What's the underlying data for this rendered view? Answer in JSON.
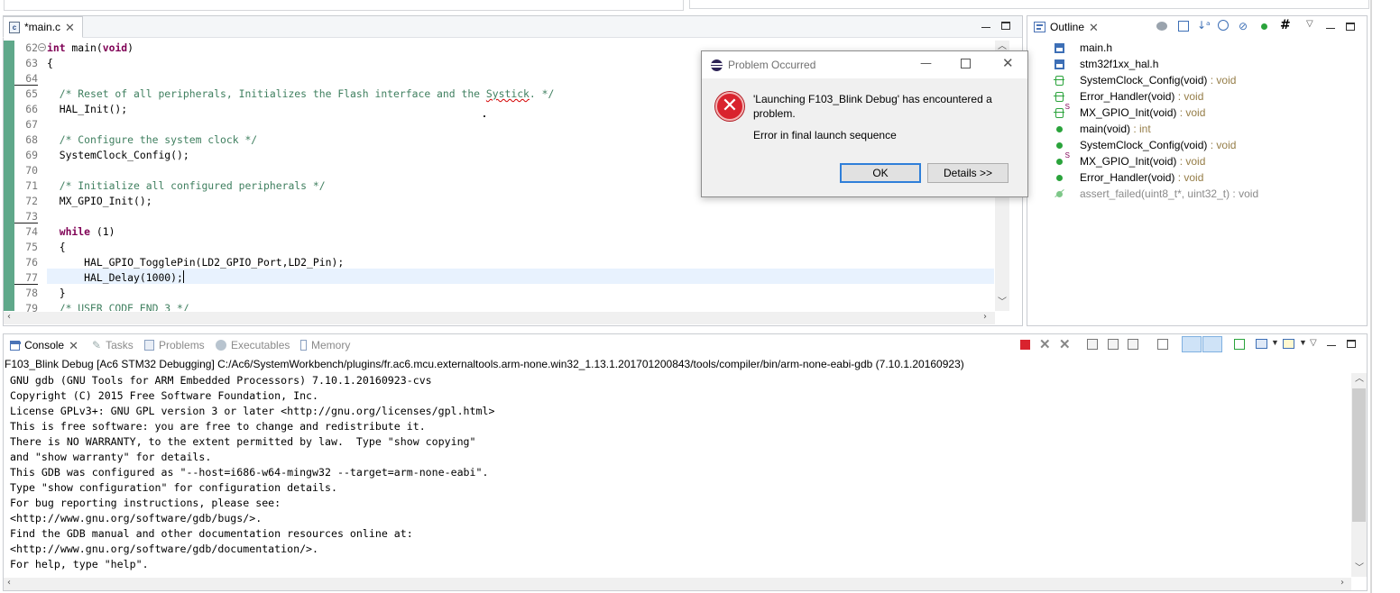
{
  "editor": {
    "tab_title": "*main.c",
    "lines": [
      {
        "num": "62",
        "text": "int main(void)"
      },
      {
        "num": "63",
        "text": "{"
      },
      {
        "num": "64",
        "text": ""
      },
      {
        "num": "65",
        "text": "  /* Reset of all peripherals, Initializes the Flash interface and the Systick. */"
      },
      {
        "num": "66",
        "text": "  HAL_Init();"
      },
      {
        "num": "67",
        "text": ""
      },
      {
        "num": "68",
        "text": "  /* Configure the system clock */"
      },
      {
        "num": "69",
        "text": "  SystemClock_Config();"
      },
      {
        "num": "70",
        "text": ""
      },
      {
        "num": "71",
        "text": "  /* Initialize all configured peripherals */"
      },
      {
        "num": "72",
        "text": "  MX_GPIO_Init();"
      },
      {
        "num": "73",
        "text": ""
      },
      {
        "num": "74",
        "text": "  while (1)"
      },
      {
        "num": "75",
        "text": "  {"
      },
      {
        "num": "76",
        "text": "      HAL_GPIO_TogglePin(LD2_GPIO_Port,LD2_Pin);"
      },
      {
        "num": "77",
        "text": "      HAL_Delay(1000);"
      },
      {
        "num": "78",
        "text": "  }"
      },
      {
        "num": "79",
        "text": "  /* USER CODE END 3 */"
      }
    ]
  },
  "outline": {
    "tab_title": "Outline",
    "items": [
      {
        "name": "main.h",
        "type": "",
        "icon": "header-file-icon"
      },
      {
        "name": "stm32f1xx_hal.h",
        "type": "",
        "icon": "header-file-icon"
      },
      {
        "name": "SystemClock_Config(void)",
        "type": " : void",
        "icon": "function-prototype-icon"
      },
      {
        "name": "Error_Handler(void)",
        "type": " : void",
        "icon": "function-prototype-icon"
      },
      {
        "name": "MX_GPIO_Init(void)",
        "type": " : void",
        "icon": "static-function-prototype-icon"
      },
      {
        "name": "main(void)",
        "type": " : int",
        "icon": "function-icon"
      },
      {
        "name": "SystemClock_Config(void)",
        "type": " : void",
        "icon": "function-icon"
      },
      {
        "name": "MX_GPIO_Init(void)",
        "type": " : void",
        "icon": "static-function-icon"
      },
      {
        "name": "Error_Handler(void)",
        "type": " : void",
        "icon": "function-icon"
      },
      {
        "name": "assert_failed(uint8_t*, uint32_t) : void",
        "type": "",
        "icon": "inactive-function-icon"
      }
    ]
  },
  "console": {
    "tabs": {
      "console": "Console",
      "tasks": "Tasks",
      "problems": "Problems",
      "executables": "Executables",
      "memory": "Memory"
    },
    "session_title": "F103_Blink Debug [Ac6 STM32 Debugging] C:/Ac6/SystemWorkbench/plugins/fr.ac6.mcu.externaltools.arm-none.win32_1.13.1.201701200843/tools/compiler/bin/arm-none-eabi-gdb (7.10.1.20160923)",
    "lines": [
      "GNU gdb (GNU Tools for ARM Embedded Processors) 7.10.1.20160923-cvs",
      "Copyright (C) 2015 Free Software Foundation, Inc.",
      "License GPLv3+: GNU GPL version 3 or later <http://gnu.org/licenses/gpl.html>",
      "This is free software: you are free to change and redistribute it.",
      "There is NO WARRANTY, to the extent permitted by law.  Type \"show copying\"",
      "and \"show warranty\" for details.",
      "This GDB was configured as \"--host=i686-w64-mingw32 --target=arm-none-eabi\".",
      "Type \"show configuration\" for configuration details.",
      "For bug reporting instructions, please see:",
      "<http://www.gnu.org/software/gdb/bugs/>.",
      "Find the GDB manual and other documentation resources online at:",
      "<http://www.gnu.org/software/gdb/documentation/>.",
      "For help, type \"help\"."
    ]
  },
  "dialog": {
    "title": "Problem Occurred",
    "message_line1": "'Launching F103_Blink Debug' has encountered a",
    "message_line2": "problem.",
    "detail": "Error in final launch sequence",
    "ok_label": "OK",
    "details_label": "Details >>"
  },
  "colors": {
    "keyword": "#7f0055",
    "comment": "#3f7f5f",
    "gutter_green": "#5fa88a",
    "error_red": "#d9232e",
    "default_button_border": "#2f7fd9"
  }
}
